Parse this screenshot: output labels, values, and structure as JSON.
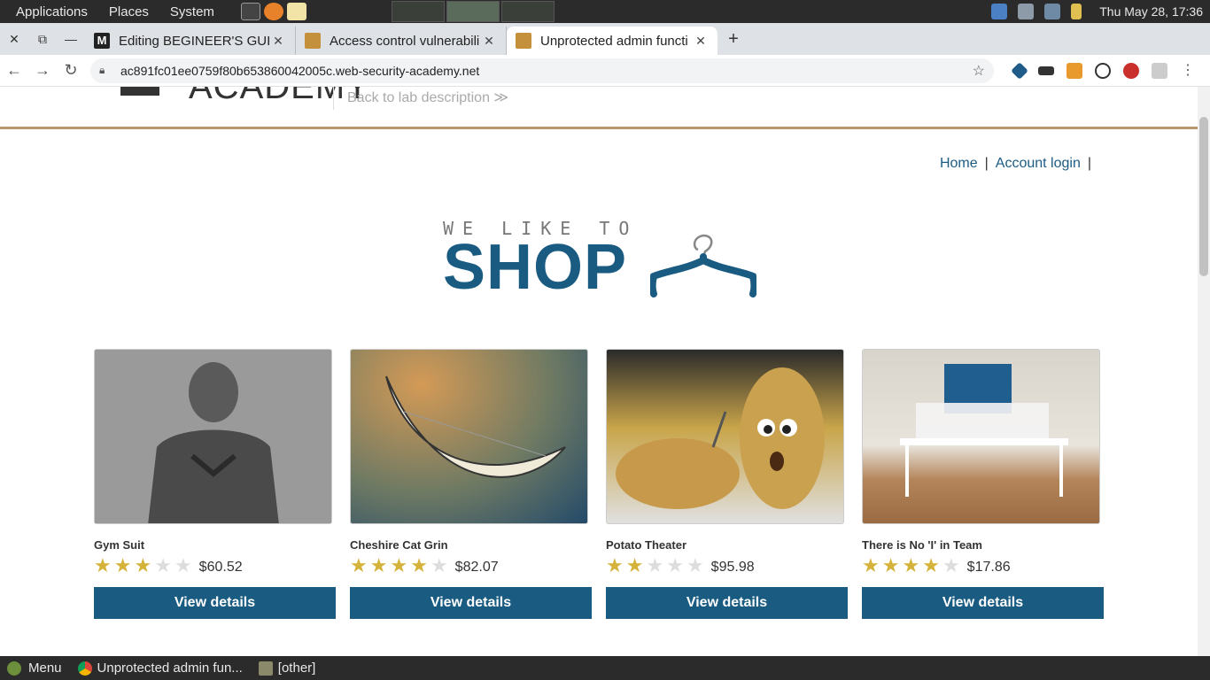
{
  "system": {
    "menus": [
      "Applications",
      "Places",
      "System"
    ],
    "clock": "Thu May 28, 17:36"
  },
  "tabs": [
    {
      "title": "Editing BEGINEER'S GUI",
      "active": false
    },
    {
      "title": "Access control vulnerabili",
      "active": false
    },
    {
      "title": "Unprotected admin functi",
      "active": true
    }
  ],
  "address_bar": {
    "url": "ac891fc01ee0759f80b653860042005c.web-security-academy.net"
  },
  "lab": {
    "brand": "ACADEMY",
    "back_link": "Back to lab description ≫"
  },
  "nav": {
    "home": "Home",
    "sep1": "|",
    "account_login": "Account login",
    "sep2": "|"
  },
  "shop_logo": {
    "small": "WE LIKE TO",
    "big": "SHOP"
  },
  "products": [
    {
      "name": "Gym Suit",
      "stars": 3,
      "price": "$60.52",
      "button": "View details"
    },
    {
      "name": "Cheshire Cat Grin",
      "stars": 4,
      "price": "$82.07",
      "button": "View details"
    },
    {
      "name": "Potato Theater",
      "stars": 2,
      "price": "$95.98",
      "button": "View details"
    },
    {
      "name": "There is No 'I' in Team",
      "stars": 4,
      "price": "$17.86",
      "button": "View details"
    }
  ],
  "taskbar": {
    "menu": "Menu",
    "tasks": [
      "Unprotected admin fun...",
      "[other]"
    ]
  },
  "colors": {
    "brand": "#1a5b82",
    "star": "#d5b33a",
    "rule": "#b9966b"
  }
}
